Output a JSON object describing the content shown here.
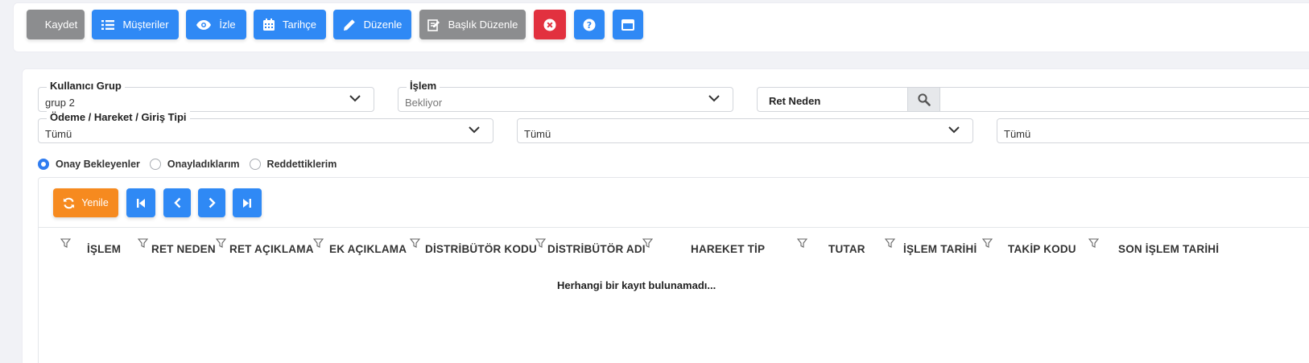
{
  "toolbar": {
    "save_label": "Kaydet",
    "customers_label": "Müşteriler",
    "watch_label": "İzle",
    "history_label": "Tarihçe",
    "edit_label": "Düzenle",
    "title_edit_label": "Başlık Düzenle"
  },
  "filters": {
    "user_group": {
      "label": "Kullanıcı Grup",
      "value": "grup 2"
    },
    "operation": {
      "label": "İşlem",
      "value": "Bekliyor"
    },
    "reject_reason": {
      "label": "Ret Neden"
    },
    "payment_type": {
      "label": "Ödeme / Hareket / Giriş Tipi",
      "value": "Tümü"
    },
    "select2": {
      "value": "Tümü"
    },
    "select3": {
      "value": "Tümü"
    }
  },
  "radios": [
    {
      "label": "Onay Bekleyenler",
      "checked": true
    },
    {
      "label": "Onayladıklarım",
      "checked": false
    },
    {
      "label": "Reddettiklerim",
      "checked": false
    }
  ],
  "grid": {
    "refresh_label": "Yenile",
    "columns": [
      "İŞLEM",
      "RET NEDEN",
      "RET AÇIKLAMA",
      "EK AÇIKLAMA",
      "DİSTRİBÜTÖR KODU",
      "DİSTRİBÜTÖR ADI",
      "HAREKET TİP",
      "TUTAR",
      "İŞLEM TARİHİ",
      "TAKİP KODU",
      "SON İŞLEM TARİHİ"
    ],
    "empty_message": "Herhangi bir kayıt bulunamadı..."
  },
  "colors": {
    "primary": "#2f89f5",
    "danger": "#e2313f",
    "warning": "#f68a1f",
    "secondary": "#8c8d8f"
  }
}
